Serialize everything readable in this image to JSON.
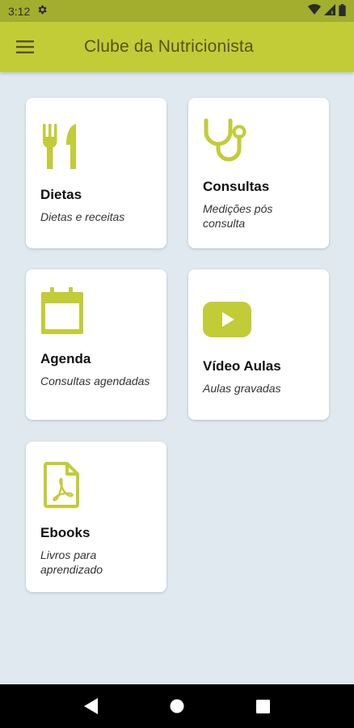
{
  "status_bar": {
    "time": "3:12",
    "icons": [
      "settings-icon",
      "wifi-icon",
      "signal-icon",
      "battery-icon"
    ]
  },
  "app_bar": {
    "title": "Clube da Nutricionista",
    "menu_icon": "hamburger-menu-icon"
  },
  "colors": {
    "accent": "#c2cc37",
    "status_bar": "#a3ad2e",
    "background": "#e0e9ef",
    "title_text": "#545414"
  },
  "cards": [
    {
      "title": "Dietas",
      "subtitle": "Dietas e receitas",
      "icon": "cutlery-icon"
    },
    {
      "title": "Consultas",
      "subtitle": "Medições pós consulta",
      "icon": "stethoscope-icon"
    },
    {
      "title": "Agenda",
      "subtitle": "Consultas agendadas",
      "icon": "calendar-icon"
    },
    {
      "title": "Vídeo Aulas",
      "subtitle": "Aulas gravadas",
      "icon": "youtube-icon"
    },
    {
      "title": "Ebooks",
      "subtitle": "Livros para aprendizado",
      "icon": "pdf-icon"
    }
  ],
  "nav_bar": {
    "icons": [
      "back-icon",
      "home-icon",
      "recents-icon"
    ]
  }
}
